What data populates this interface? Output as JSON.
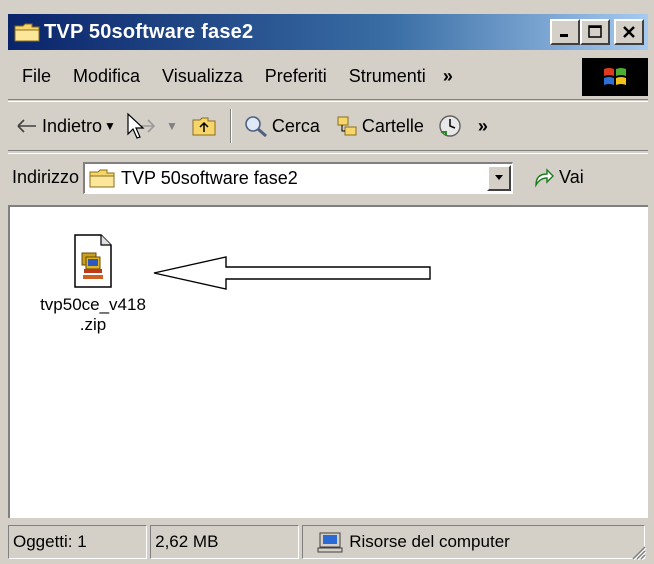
{
  "window": {
    "title": "TVP 50software fase2",
    "icon": "folder-icon",
    "controls": [
      "minimize-icon",
      "maximize-icon",
      "close-icon"
    ]
  },
  "menubar": {
    "items": [
      "File",
      "Modifica",
      "Visualizza",
      "Preferiti",
      "Strumenti"
    ],
    "overflow": "»",
    "logo": "windows-logo-icon"
  },
  "toolbar": {
    "back": "Indietro",
    "search": "Cerca",
    "folders": "Cartelle",
    "overflow": "»"
  },
  "addressbar": {
    "label": "Indirizzo",
    "value": "TVP 50software fase2",
    "go": "Vai"
  },
  "content": {
    "files": [
      {
        "name_line1": "tvp50ce_v418",
        "name_line2": ".zip",
        "icon": "zip-file-icon"
      }
    ]
  },
  "statusbar": {
    "objects": "Oggetti: 1",
    "size": "2,62 MB",
    "zone": "Risorse del computer"
  },
  "colors": {
    "titlebar_start": "#0a246a",
    "titlebar_end": "#a6caf0",
    "chrome": "#d4d0c8"
  }
}
